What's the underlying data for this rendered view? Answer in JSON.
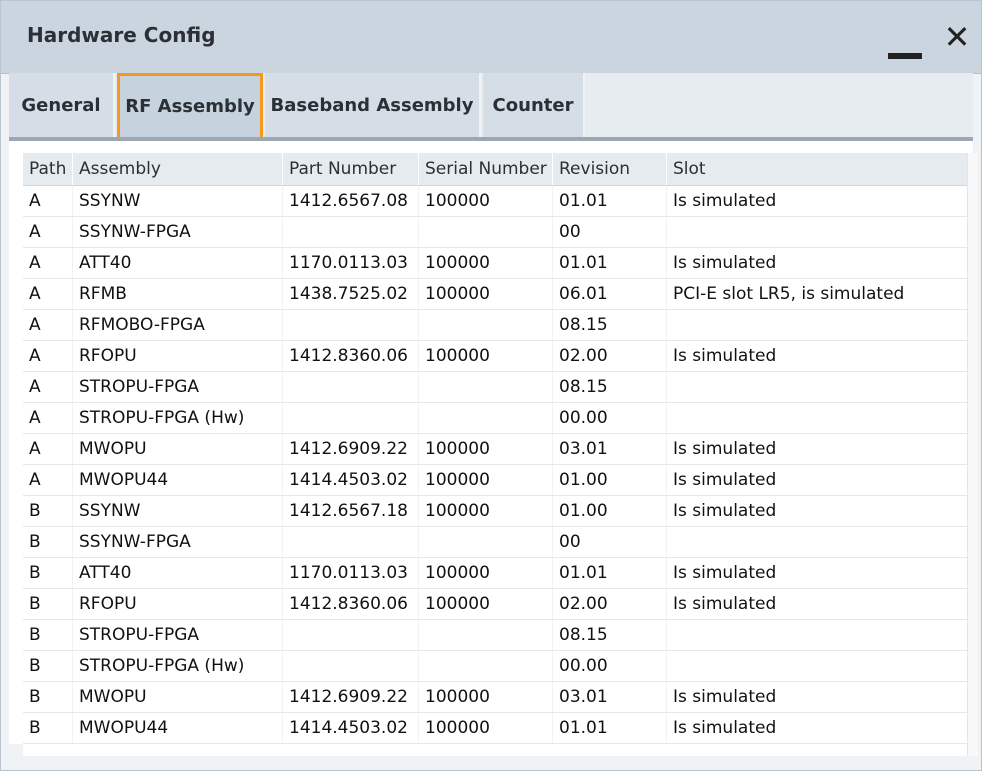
{
  "window": {
    "title": "Hardware Config",
    "minimize_icon": "minimize-icon",
    "close_icon": "close-icon",
    "close_glyph": "✕"
  },
  "tabs": [
    {
      "label": "General",
      "active": false
    },
    {
      "label": "RF Assembly",
      "active": true
    },
    {
      "label": "Baseband Assembly",
      "active": false
    },
    {
      "label": "Counter",
      "active": false
    }
  ],
  "table": {
    "headers": [
      "Path",
      "Assembly",
      "Part Number",
      "Serial Number",
      "Revision",
      "Slot"
    ],
    "rows": [
      [
        "A",
        "SSYNW",
        "1412.6567.08",
        "100000",
        "01.01",
        "Is simulated"
      ],
      [
        "A",
        "SSYNW-FPGA",
        "",
        "",
        "00",
        ""
      ],
      [
        "A",
        "ATT40",
        "1170.0113.03",
        "100000",
        "01.01",
        "Is simulated"
      ],
      [
        "A",
        "RFMB",
        "1438.7525.02",
        "100000",
        "06.01",
        "PCI-E slot LR5, is simulated"
      ],
      [
        "A",
        "RFMOBO-FPGA",
        "",
        "",
        "08.15",
        ""
      ],
      [
        "A",
        "RFOPU",
        "1412.8360.06",
        "100000",
        "02.00",
        "Is simulated"
      ],
      [
        "A",
        "STROPU-FPGA",
        "",
        "",
        "08.15",
        ""
      ],
      [
        "A",
        "STROPU-FPGA (Hw)",
        "",
        "",
        "00.00",
        ""
      ],
      [
        "A",
        "MWOPU",
        "1412.6909.22",
        "100000",
        "03.01",
        "Is simulated"
      ],
      [
        "A",
        "MWOPU44",
        "1414.4503.02",
        "100000",
        "01.00",
        "Is simulated"
      ],
      [
        "B",
        "SSYNW",
        "1412.6567.18",
        "100000",
        "01.00",
        "Is simulated"
      ],
      [
        "B",
        "SSYNW-FPGA",
        "",
        "",
        "00",
        ""
      ],
      [
        "B",
        "ATT40",
        "1170.0113.03",
        "100000",
        "01.01",
        "Is simulated"
      ],
      [
        "B",
        "RFOPU",
        "1412.8360.06",
        "100000",
        "02.00",
        "Is simulated"
      ],
      [
        "B",
        "STROPU-FPGA",
        "",
        "",
        "08.15",
        ""
      ],
      [
        "B",
        "STROPU-FPGA (Hw)",
        "",
        "",
        "00.00",
        ""
      ],
      [
        "B",
        "MWOPU",
        "1412.6909.22",
        "100000",
        "03.01",
        "Is simulated"
      ],
      [
        "B",
        "MWOPU44",
        "1414.4503.02",
        "100000",
        "01.01",
        "Is simulated"
      ]
    ]
  },
  "colors": {
    "active_tab_border": "#f39a1e",
    "titlebar": "#cad5df"
  }
}
